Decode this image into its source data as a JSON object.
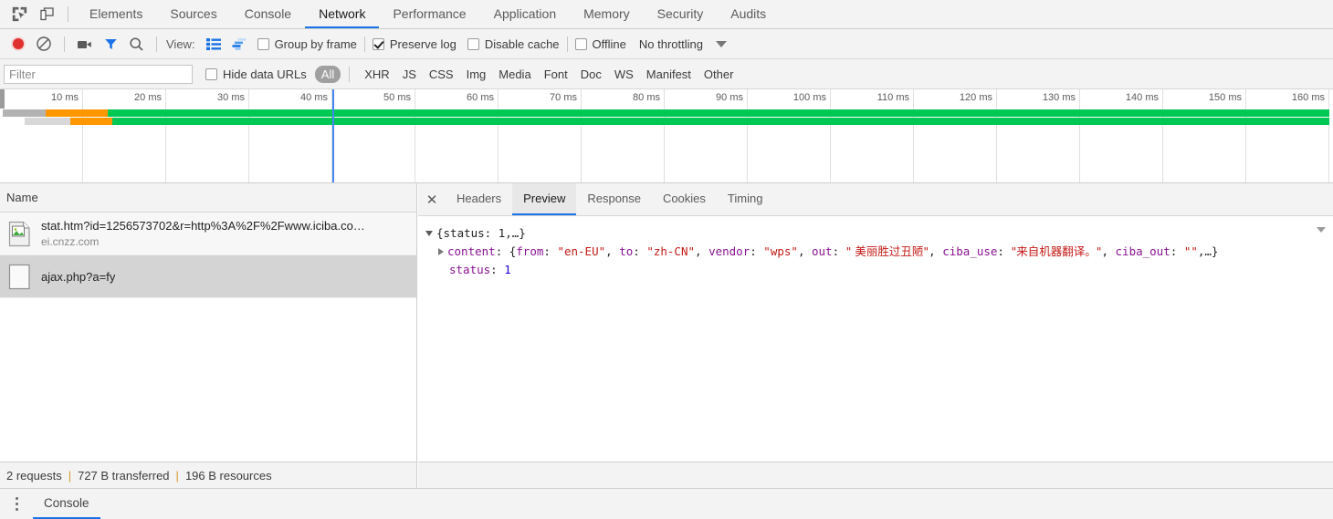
{
  "window": {
    "inspect_icon": "inspect-element-icon",
    "device_icon": "device-toolbar-icon"
  },
  "tabs": [
    {
      "label": "Elements",
      "active": false
    },
    {
      "label": "Sources",
      "active": false
    },
    {
      "label": "Console",
      "active": false
    },
    {
      "label": "Network",
      "active": true
    },
    {
      "label": "Performance",
      "active": false
    },
    {
      "label": "Application",
      "active": false
    },
    {
      "label": "Memory",
      "active": false
    },
    {
      "label": "Security",
      "active": false
    },
    {
      "label": "Audits",
      "active": false
    }
  ],
  "controls": {
    "record_icon": "record-icon",
    "clear_icon": "clear-icon",
    "camera_icon": "camera-icon",
    "filter_icon": "filter-icon",
    "search_icon": "search-icon",
    "view_label": "View:",
    "view_list_icon": "list-view-icon",
    "view_waterfall_icon": "waterfall-view-icon",
    "group_by_frame": {
      "label": "Group by frame",
      "checked": false
    },
    "preserve_log": {
      "label": "Preserve log",
      "checked": true
    },
    "disable_cache": {
      "label": "Disable cache",
      "checked": false
    },
    "offline": {
      "label": "Offline",
      "checked": false
    },
    "throttling": "No throttling",
    "throttling_caret_icon": "chevron-down-icon"
  },
  "filter": {
    "placeholder": "Filter",
    "value": "",
    "hide_data_urls": {
      "label": "Hide data URLs",
      "checked": false
    },
    "types": [
      {
        "label": "All",
        "active": true
      },
      {
        "label": "XHR",
        "active": false
      },
      {
        "label": "JS",
        "active": false
      },
      {
        "label": "CSS",
        "active": false
      },
      {
        "label": "Img",
        "active": false
      },
      {
        "label": "Media",
        "active": false
      },
      {
        "label": "Font",
        "active": false
      },
      {
        "label": "Doc",
        "active": false
      },
      {
        "label": "WS",
        "active": false
      },
      {
        "label": "Manifest",
        "active": false
      },
      {
        "label": "Other",
        "active": false
      }
    ]
  },
  "overview": {
    "ticks": [
      "10 ms",
      "20 ms",
      "30 ms",
      "40 ms",
      "50 ms",
      "60 ms",
      "70 ms",
      "80 ms",
      "90 ms",
      "100 ms",
      "110 ms",
      "120 ms",
      "130 ms",
      "140 ms",
      "150 ms",
      "160 ms"
    ],
    "tick_spacing_px": 91,
    "dom_marker_ms": 40,
    "bars": [
      {
        "queue_color": "#b3b3b3",
        "queue_start_ms": 0.3,
        "queue_end_ms": 5.5,
        "wait_color": "#ff9800",
        "wait_start_ms": 5.5,
        "wait_end_ms": 13.0,
        "download_color": "#00c853",
        "download_start_ms": 13.0,
        "download_end_ms": 160.0
      },
      {
        "queue_color": "#d8d8d8",
        "queue_start_ms": 3.0,
        "queue_end_ms": 8.5,
        "wait_color": "#ff9800",
        "wait_start_ms": 8.5,
        "wait_end_ms": 13.5,
        "download_color": "#00c853",
        "download_start_ms": 13.5,
        "download_end_ms": 160.0
      }
    ]
  },
  "requests": {
    "column_header": "Name",
    "rows": [
      {
        "icon": "image-file-icon",
        "name": "stat.htm?id=1256573702&r=http%3A%2F%2Fwww.iciba.co…",
        "domain": "ei.cnzz.com",
        "selected": false
      },
      {
        "icon": "generic-file-icon",
        "name": "ajax.php?a=fy",
        "domain": "",
        "selected": true
      }
    ]
  },
  "detail": {
    "close_icon": "close-icon",
    "tabs": [
      {
        "label": "Headers",
        "active": false
      },
      {
        "label": "Preview",
        "active": true
      },
      {
        "label": "Response",
        "active": false
      },
      {
        "label": "Cookies",
        "active": false
      },
      {
        "label": "Timing",
        "active": false
      }
    ],
    "preview": {
      "line1": {
        "expander": "expanded",
        "text": "{status: 1,…}"
      },
      "line2": {
        "expander": "collapsed",
        "prop": "content",
        "colon": ": ",
        "open": "{",
        "pairs": [
          {
            "key": "from",
            "sep": ": ",
            "value": "\"en-EU\"",
            "type": "string"
          },
          {
            "key": "to",
            "sep": ": ",
            "value": "\"zh-CN\"",
            "type": "string"
          },
          {
            "key": "vendor",
            "sep": ": ",
            "value": "\"wps\"",
            "type": "string"
          },
          {
            "key": "out",
            "sep": ": ",
            "value": "\" 美丽胜过丑陋\"",
            "type": "string"
          },
          {
            "key": "ciba_use",
            "sep": ": ",
            "value": "\"来自机器翻译。\"",
            "type": "string"
          },
          {
            "key": "ciba_out",
            "sep": ": ",
            "value": "\"\"",
            "type": "string"
          }
        ],
        "tail": ",…}"
      },
      "line3": {
        "prop": "status",
        "colon": ": ",
        "value": "1",
        "type": "number"
      }
    },
    "caret_icon": "chevron-down-icon"
  },
  "status_bar": {
    "requests": "2 requests",
    "transferred": "727 B transferred",
    "resources": "196 B resources",
    "separator": "|"
  },
  "drawer": {
    "menu_icon": "more-options-icon",
    "tab": "Console"
  },
  "colors": {
    "accent": "#1a73e8",
    "download": "#00c853",
    "waiting": "#ff9800",
    "queue": "#b3b3b3",
    "marker": "#4285f4",
    "filter_blue": "#1a73e8",
    "record_red": "#e03030"
  }
}
